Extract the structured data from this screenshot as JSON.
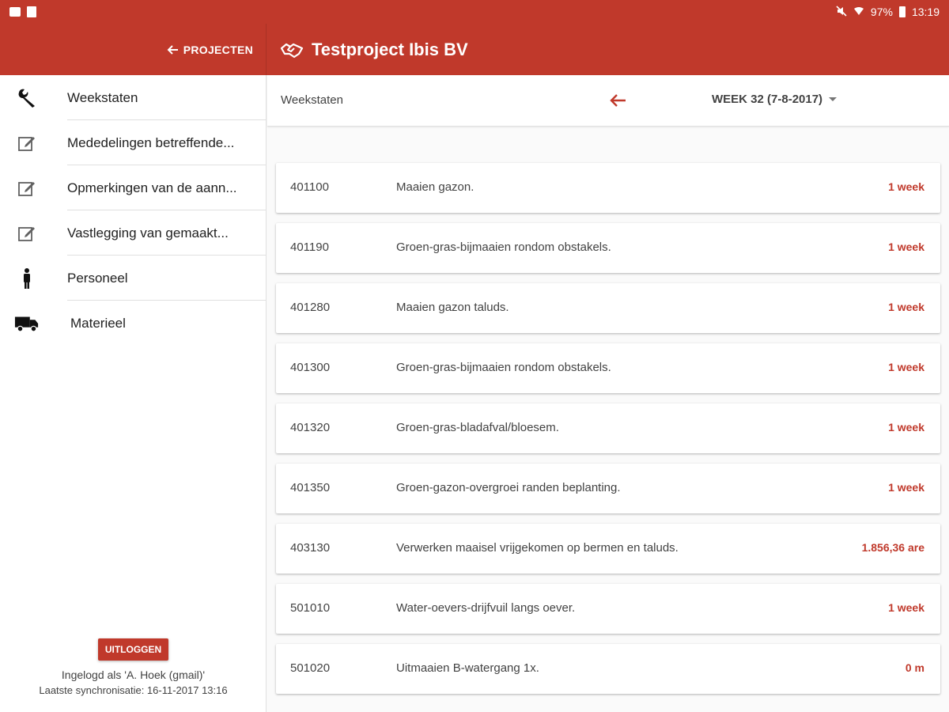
{
  "status_bar": {
    "battery": "97%",
    "time": "13:19"
  },
  "appbar": {
    "projecten_label": "PROJECTEN",
    "title": "Testproject Ibis BV"
  },
  "sidebar": {
    "items": [
      {
        "label": "Weekstaten",
        "icon": "wrench-icon"
      },
      {
        "label": "Mededelingen betreffende...",
        "icon": "edit-icon"
      },
      {
        "label": "Opmerkingen van de aann...",
        "icon": "edit-icon"
      },
      {
        "label": "Vastlegging van gemaakt...",
        "icon": "edit-icon"
      },
      {
        "label": "Personeel",
        "icon": "person-icon"
      },
      {
        "label": "Materieel",
        "icon": "truck-icon"
      }
    ],
    "logout_label": "UITLOGGEN",
    "logged_in_text": "Ingelogd als 'A. Hoek (gmail)'",
    "last_sync_text": "Laatste synchronisatie: 16-11-2017 13:16"
  },
  "toolbar": {
    "label": "Weekstaten",
    "week_selected": "WEEK 32 (7-8-2017)"
  },
  "rows": [
    {
      "code": "401100",
      "description": "Maaien gazon.",
      "quantity": "1 week"
    },
    {
      "code": "401190",
      "description": "Groen-gras-bijmaaien rondom obstakels.",
      "quantity": "1 week"
    },
    {
      "code": "401280",
      "description": "Maaien gazon taluds.",
      "quantity": "1 week"
    },
    {
      "code": "401300",
      "description": "Groen-gras-bijmaaien rondom obstakels.",
      "quantity": "1 week"
    },
    {
      "code": "401320",
      "description": "Groen-gras-bladafval/bloesem.",
      "quantity": "1 week"
    },
    {
      "code": "401350",
      "description": "Groen-gazon-overgroei randen beplanting.",
      "quantity": "1 week"
    },
    {
      "code": "403130",
      "description": "Verwerken maaisel vrijgekomen op bermen en taluds.",
      "quantity": "1.856,36 are"
    },
    {
      "code": "501010",
      "description": "Water-oevers-drijfvuil langs oever.",
      "quantity": "1 week"
    },
    {
      "code": "501020",
      "description": "Uitmaaien B-watergang 1x.",
      "quantity": "0 m"
    }
  ],
  "colors": {
    "primary": "#c0392b",
    "accent_text": "#c0392b"
  }
}
